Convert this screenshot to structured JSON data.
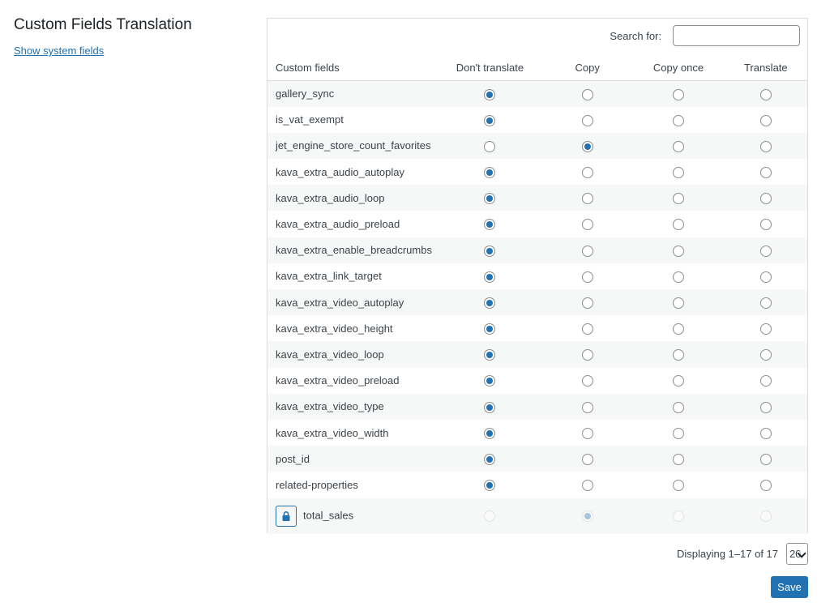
{
  "page": {
    "title": "Custom Fields Translation",
    "show_system_fields": "Show system fields"
  },
  "search": {
    "label": "Search for:",
    "value": "",
    "placeholder": ""
  },
  "table": {
    "headers": [
      "Custom fields",
      "Don't translate",
      "Copy",
      "Copy once",
      "Translate"
    ],
    "option_keys": [
      "dont_translate",
      "copy",
      "copy_once",
      "translate"
    ],
    "rows": [
      {
        "field": "gallery_sync",
        "selected": 0
      },
      {
        "field": "is_vat_exempt",
        "selected": 0
      },
      {
        "field": "jet_engine_store_count_favorites",
        "selected": 1
      },
      {
        "field": "kava_extra_audio_autoplay",
        "selected": 0
      },
      {
        "field": "kava_extra_audio_loop",
        "selected": 0
      },
      {
        "field": "kava_extra_audio_preload",
        "selected": 0
      },
      {
        "field": "kava_extra_enable_breadcrumbs",
        "selected": 0
      },
      {
        "field": "kava_extra_link_target",
        "selected": 0
      },
      {
        "field": "kava_extra_video_autoplay",
        "selected": 0
      },
      {
        "field": "kava_extra_video_height",
        "selected": 0
      },
      {
        "field": "kava_extra_video_loop",
        "selected": 0
      },
      {
        "field": "kava_extra_video_preload",
        "selected": 0
      },
      {
        "field": "kava_extra_video_type",
        "selected": 0
      },
      {
        "field": "kava_extra_video_width",
        "selected": 0
      },
      {
        "field": "post_id",
        "selected": 0
      },
      {
        "field": "related-properties",
        "selected": 0
      },
      {
        "field": "total_sales",
        "selected": 1,
        "locked": true,
        "lock_icon": "lock-icon"
      }
    ]
  },
  "pagination": {
    "displaying": "Displaying 1–17 of 17",
    "per_page": "20"
  },
  "actions": {
    "save_label": "Save"
  },
  "colors": {
    "accent": "#2271b1",
    "row_alt": "#f6f7f7",
    "border": "#dcdcde"
  }
}
